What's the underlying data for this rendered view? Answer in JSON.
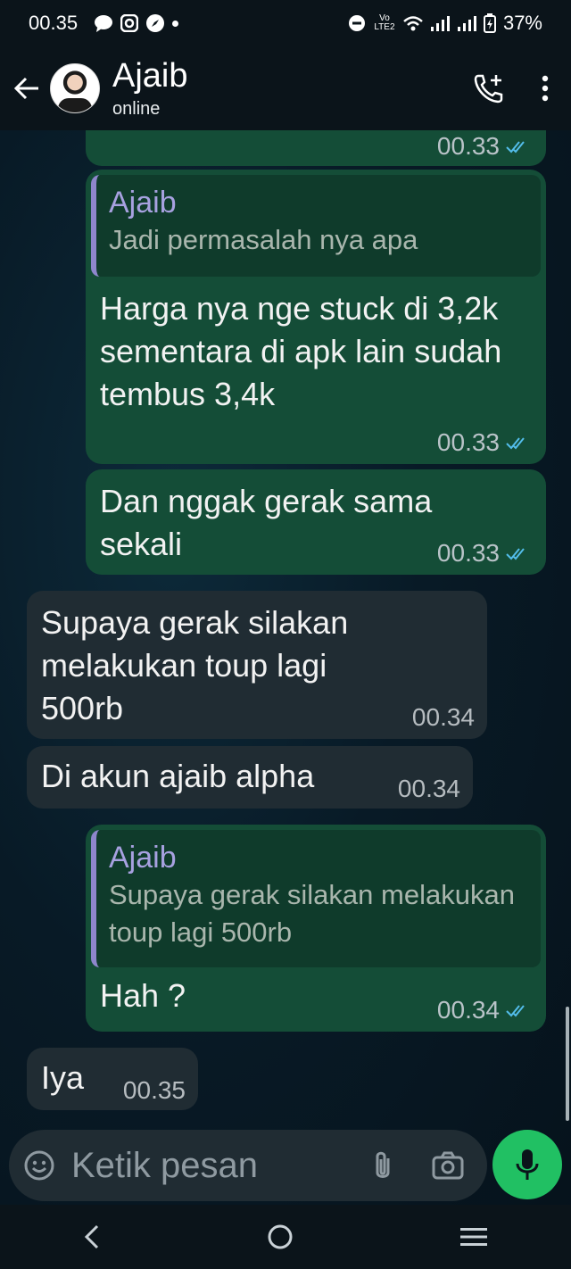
{
  "status_bar": {
    "time": "00.35",
    "battery": "37%",
    "network_label": "Vo LTE2"
  },
  "header": {
    "contact_name": "Ajaib",
    "presence": "online"
  },
  "messages": [
    {
      "id": "m0",
      "time": "00.33"
    },
    {
      "id": "m1",
      "quote_author": "Ajaib",
      "quote_text": "Jadi permasalah nya apa",
      "text": "Harga nya nge stuck di 3,2k sementara di apk lain sudah tembus 3,4k",
      "time": "00.33"
    },
    {
      "id": "m2",
      "text": "Dan nggak gerak sama sekali",
      "time": "00.33"
    },
    {
      "id": "m3",
      "text": "Supaya gerak silakan melakukan toup lagi 500rb",
      "time": "00.34"
    },
    {
      "id": "m4",
      "text": "Di akun ajaib alpha",
      "time": "00.34"
    },
    {
      "id": "m5",
      "quote_author": "Ajaib",
      "quote_text": "Supaya gerak silakan melakukan toup lagi 500rb",
      "text": "Hah ?",
      "time": "00.34"
    },
    {
      "id": "m6",
      "text": "Iya",
      "time": "00.35"
    }
  ],
  "composer": {
    "placeholder": "Ketik pesan"
  },
  "icons": {
    "back": "arrow-left-icon",
    "call": "add-call-icon",
    "menu": "more-vertical-icon",
    "emoji": "sticker-icon",
    "attach": "paperclip-icon",
    "camera": "camera-icon",
    "mic": "microphone-icon",
    "read_ticks": "double-check-icon"
  },
  "colors": {
    "outgoing_bubble": "#144d37",
    "incoming_bubble": "#202c33",
    "read_ticks": "#53bdeb",
    "accent": "#21c063",
    "quote_bar": "#8e86cc"
  }
}
